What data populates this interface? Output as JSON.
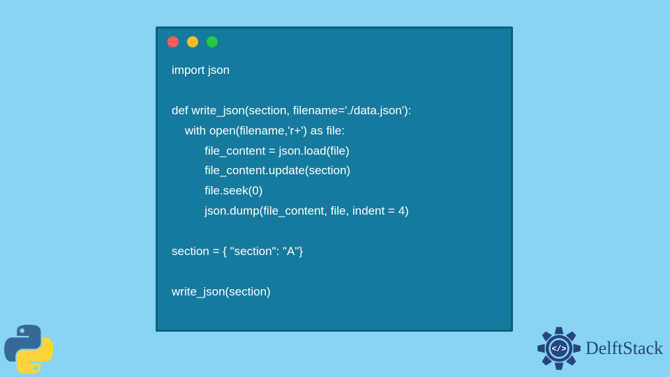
{
  "window": {
    "dots": {
      "red": "#ff5f57",
      "yellow": "#febc2e",
      "green": "#28c840"
    }
  },
  "code": {
    "lines": [
      "import json",
      "",
      "def write_json(section, filename='./data.json'):",
      "    with open(filename,'r+') as file:",
      "          file_content = json.load(file)",
      "          file_content.update(section)",
      "          file.seek(0)",
      "          json.dump(file_content, file, indent = 4)",
      "",
      "section = { \"section\": \"A\"}",
      "",
      "write_json(section)"
    ]
  },
  "branding": {
    "delftstack_label": "DelftStack",
    "python_logo_alt": "python-logo",
    "colors": {
      "page_bg": "#87d4f4",
      "window_bg": "#157a9e",
      "window_border": "#0d5f7c",
      "code_text": "#ffffff",
      "delft_blue": "#26457d",
      "python_blue": "#366a96",
      "python_yellow": "#ffd43b"
    }
  }
}
